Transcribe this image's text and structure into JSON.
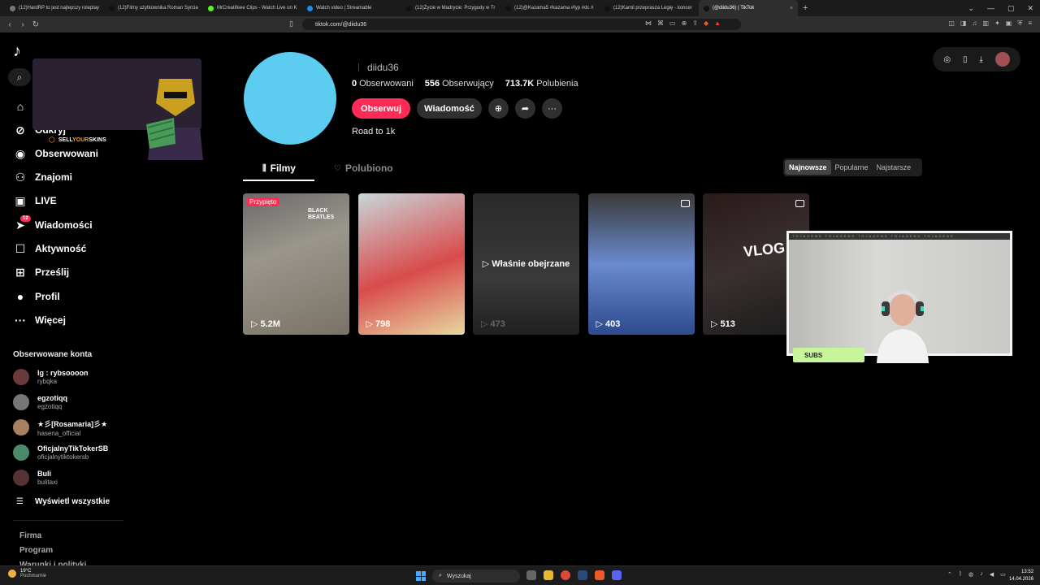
{
  "browser": {
    "tabs": [
      {
        "label": "(12)HardRP to jest najlepszy roleplay",
        "fav": "#777"
      },
      {
        "label": "(12)Filmy użytkownika Roman Syrcia",
        "fav": "#111"
      },
      {
        "label": "MrCreatifeee Clips - Watch Live on K",
        "fav": "#53fc18"
      },
      {
        "label": "Watch video | Streamable",
        "fav": "#0f90fa"
      },
      {
        "label": "(12)Życie w Madrycie: Przygody w Tr",
        "fav": "#111"
      },
      {
        "label": "(12)@Kazama5 #kazama #fyp #dc #",
        "fav": "#111"
      },
      {
        "label": "(12)Kamil przeprasza Legię - koncer",
        "fav": "#111"
      },
      {
        "label": "(@diidu36) | TikTok",
        "fav": "#111"
      }
    ],
    "active_tab": 7,
    "url": "tiktok.com/@diidu36"
  },
  "sidebar": {
    "logo": "♪",
    "nav": [
      {
        "name": "nav-for-you",
        "icon": "⌂",
        "label": "",
        "icon_name": "home-icon"
      },
      {
        "name": "nav-explore",
        "icon": "⊘",
        "label": "Odkryj",
        "icon_name": "compass-icon"
      },
      {
        "name": "nav-following",
        "icon": "◉",
        "label": "Obserwowani",
        "icon_name": "following-avatar-icon"
      },
      {
        "name": "nav-friends",
        "icon": "⚇",
        "label": "Znajomi",
        "icon_name": "friends-icon"
      },
      {
        "name": "nav-live",
        "icon": "▣",
        "label": "LIVE",
        "icon_name": "live-icon"
      },
      {
        "name": "nav-messages",
        "icon": "➤",
        "label": "Wiadomości",
        "icon_name": "send-icon",
        "badge": "12"
      },
      {
        "name": "nav-activity",
        "icon": "☐",
        "label": "Aktywność",
        "icon_name": "activity-icon"
      },
      {
        "name": "nav-upload",
        "icon": "⊞",
        "label": "Prześlij",
        "icon_name": "upload-icon"
      },
      {
        "name": "nav-profile",
        "icon": "●",
        "label": "Profil",
        "icon_name": "profile-avatar-icon"
      },
      {
        "name": "nav-more",
        "icon": "···",
        "label": "Więcej",
        "icon_name": "more-icon"
      }
    ],
    "followed_title": "Obserwowane konta",
    "accounts": [
      {
        "name": "lg : rybsoooon",
        "handle": "rybqka",
        "color": "#6a3a3a"
      },
      {
        "name": "egzotiqq",
        "handle": "egzotiqq",
        "color": "#777"
      },
      {
        "name": "★彡[Rosamaria]彡★",
        "handle": "hasena_official",
        "color": "#a88060"
      },
      {
        "name": "OficjalnyTikTokerSB",
        "handle": "oficjalnytiktokersb",
        "color": "#4a8a6a"
      },
      {
        "name": "Buli",
        "handle": "bulitaxi",
        "color": "#553333"
      }
    ],
    "show_all": "Wyświetl wszystkie",
    "footer": [
      "Firma",
      "Program",
      "Warunki i polityki"
    ]
  },
  "ad": {
    "brand_prefix": "SELL",
    "brand_y": "YOUR",
    "brand_suffix": "SKINS"
  },
  "profile": {
    "username": "diidu36",
    "following_count": "0",
    "following_label": "Obserwowani",
    "followers_count": "556",
    "followers_label": "Obserwujący",
    "likes_count": "713.7K",
    "likes_label": "Polubienia",
    "follow_btn": "Obserwuj",
    "message_btn": "Wiadomość",
    "bio": "Road to 1k",
    "avatar_color": "#5ccdf0"
  },
  "tabs": {
    "videos": "Filmy",
    "liked": "Polubiono"
  },
  "sort": [
    "Najnowsze",
    "Popularne",
    "Najstarsze"
  ],
  "videos": [
    {
      "views": "5.2M",
      "pinned": "Przypięto",
      "bg": "linear-gradient(160deg,#6a6a6a 0%,#9a968c 40%,#7a7266 100%)",
      "overlay_text": "BLACK BEATLES"
    },
    {
      "views": "798",
      "bg": "linear-gradient(160deg,#c9d6da 0%,#d94b4b 55%,#e7d7a0 100%)"
    },
    {
      "views": "473",
      "center": "Właśnie obejrzane",
      "bg": "linear-gradient(180deg,#2a2a2a 0%,#3a3a3a 60%,#202020 100%)"
    },
    {
      "views": "403",
      "bg": "linear-gradient(180deg,#3a3a3a 0%,#6a8ad0 50%,#2c4a8c 100%)",
      "photo": true
    },
    {
      "views": "513",
      "bg": "linear-gradient(160deg,#2a1a1a 0%,#3a3030 50%,#1a1a1a 100%)",
      "photo": true,
      "overlay_text": "VLOG #2"
    }
  ],
  "webcam": {
    "stripe": "TOJAGENS TOJAGENS TOJAGENS TOJAGENS TOJAGENS",
    "subs": "SUBS"
  },
  "taskbar": {
    "temp": "19°C",
    "weather": "Pochmurnie",
    "search": "Wyszukaj",
    "time": "13:52",
    "date": "14.04.2026"
  }
}
